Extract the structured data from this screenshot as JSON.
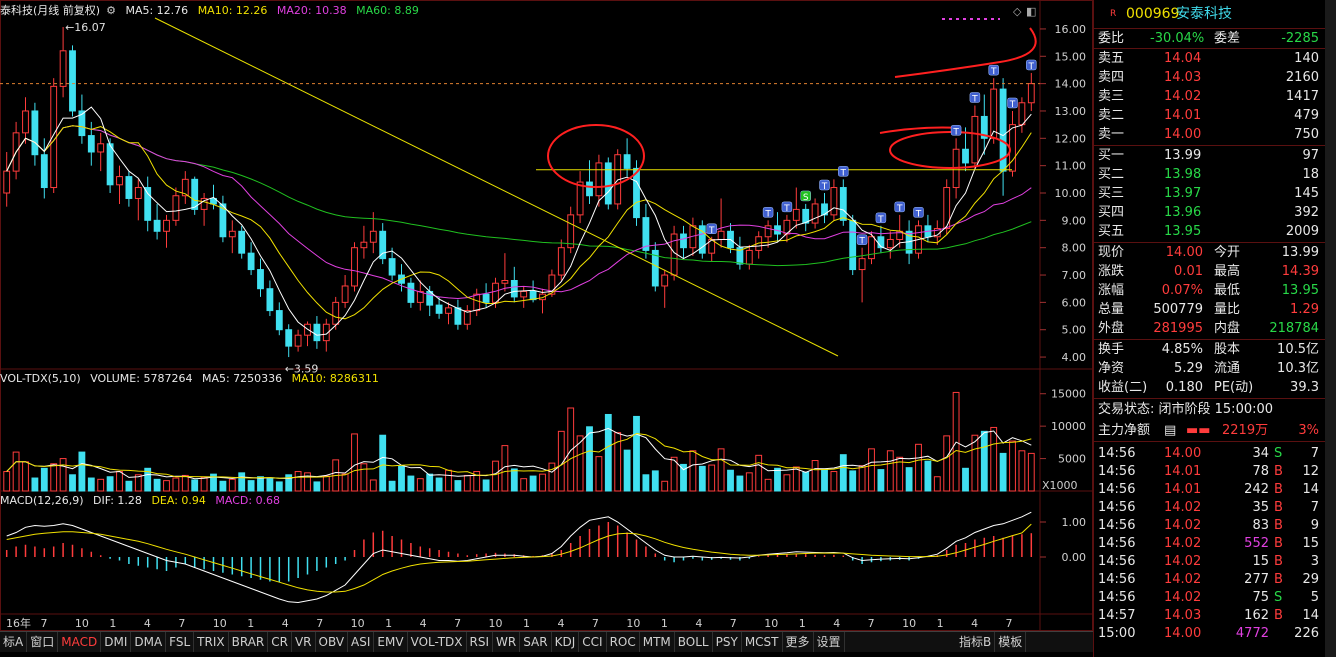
{
  "colors": {
    "up": "#ff3c3c",
    "down": "#40e0f0",
    "ma5": "#ffffff",
    "ma10": "#f0e000",
    "ma20": "#e040e0",
    "ma60": "#20c020",
    "grid": "#5a1010"
  },
  "main_header": {
    "title": "泰科技(月线 前复权)",
    "ma5": "MA5: 12.76",
    "ma10": "MA10: 12.26",
    "ma20": "MA20: 10.38",
    "ma60": "MA60: 8.89"
  },
  "price_axis": [
    "16.00",
    "15.00",
    "14.00",
    "13.00",
    "12.00",
    "11.00",
    "10.00",
    "9.00",
    "8.00",
    "7.00",
    "6.00",
    "5.00",
    "4.00"
  ],
  "annotations": {
    "high": "16.07",
    "low": "3.59"
  },
  "vol_header": {
    "name": "VOL-TDX(5,10)",
    "volume": "VOLUME: 5787264",
    "ma5": "MA5: 7250336",
    "ma10": "MA10: 8286311"
  },
  "vol_axis": [
    "15000",
    "10000",
    "5000"
  ],
  "vol_unit": "X1000",
  "macd_header": {
    "name": "MACD(12,26,9)",
    "dif": "DIF: 1.28",
    "dea": "DEA: 0.94",
    "macd": "MACD: 0.68"
  },
  "macd_axis": [
    "1.00",
    "0.00"
  ],
  "x_labels": [
    "16年",
    "7",
    "10",
    "1",
    "4",
    "7",
    "10",
    "1",
    "4",
    "7",
    "10",
    "1",
    "4",
    "7",
    "10",
    "1",
    "4",
    "7",
    "10",
    "1",
    "4",
    "7",
    "10",
    "1",
    "4",
    "7",
    "10",
    "1",
    "4",
    "7"
  ],
  "chart_data": {
    "type": "candlestick",
    "title": "泰科技(月线 前复权)",
    "ylim": [
      3.6,
      16.4
    ],
    "ohlc": [
      [
        10.0,
        11.5,
        9.5,
        10.8
      ],
      [
        10.8,
        12.6,
        10.5,
        12.2
      ],
      [
        12.2,
        13.5,
        11.8,
        13.0
      ],
      [
        13.0,
        13.3,
        11.0,
        11.4
      ],
      [
        11.4,
        12.0,
        9.8,
        10.2
      ],
      [
        10.2,
        14.2,
        10.0,
        13.9
      ],
      [
        13.9,
        16.07,
        13.5,
        15.2
      ],
      [
        15.2,
        15.4,
        12.8,
        13.0
      ],
      [
        13.0,
        13.6,
        11.8,
        12.1
      ],
      [
        12.1,
        12.6,
        11.0,
        11.5
      ],
      [
        11.5,
        12.2,
        10.8,
        11.8
      ],
      [
        11.8,
        12.0,
        10.0,
        10.3
      ],
      [
        10.3,
        11.0,
        9.6,
        10.6
      ],
      [
        10.6,
        10.8,
        9.5,
        9.8
      ],
      [
        9.8,
        10.5,
        9.0,
        10.2
      ],
      [
        10.2,
        10.6,
        8.6,
        9.0
      ],
      [
        9.0,
        9.6,
        8.3,
        8.6
      ],
      [
        8.6,
        9.2,
        8.0,
        9.0
      ],
      [
        9.0,
        10.2,
        8.8,
        9.9
      ],
      [
        9.9,
        10.8,
        9.6,
        10.5
      ],
      [
        10.5,
        10.6,
        9.2,
        9.4
      ],
      [
        9.4,
        10.0,
        8.8,
        9.8
      ],
      [
        9.8,
        10.3,
        9.4,
        9.6
      ],
      [
        9.6,
        9.9,
        8.2,
        8.4
      ],
      [
        8.4,
        9.0,
        7.8,
        8.6
      ],
      [
        8.6,
        8.8,
        7.6,
        7.8
      ],
      [
        7.8,
        8.2,
        7.0,
        7.2
      ],
      [
        7.2,
        7.6,
        6.2,
        6.5
      ],
      [
        6.5,
        6.8,
        5.5,
        5.7
      ],
      [
        5.7,
        6.0,
        4.8,
        5.0
      ],
      [
        5.0,
        5.2,
        4.0,
        4.4
      ],
      [
        4.4,
        5.0,
        4.2,
        4.8
      ],
      [
        4.8,
        5.3,
        4.4,
        5.2
      ],
      [
        5.2,
        5.5,
        4.3,
        4.6
      ],
      [
        4.6,
        5.4,
        4.2,
        5.2
      ],
      [
        5.2,
        6.2,
        5.0,
        6.0
      ],
      [
        6.0,
        7.0,
        5.8,
        6.6
      ],
      [
        6.6,
        8.2,
        6.4,
        8.0
      ],
      [
        8.0,
        8.8,
        7.6,
        8.2
      ],
      [
        8.2,
        9.3,
        7.8,
        8.6
      ],
      [
        8.6,
        8.9,
        7.4,
        7.6
      ],
      [
        7.6,
        8.0,
        6.8,
        7.0
      ],
      [
        7.0,
        7.4,
        6.4,
        6.7
      ],
      [
        6.7,
        6.9,
        5.8,
        6.0
      ],
      [
        6.0,
        6.8,
        5.7,
        6.4
      ],
      [
        6.4,
        6.6,
        5.5,
        5.9
      ],
      [
        5.9,
        6.2,
        5.4,
        5.6
      ],
      [
        5.6,
        6.0,
        5.2,
        5.8
      ],
      [
        5.8,
        6.1,
        5.0,
        5.2
      ],
      [
        5.2,
        5.9,
        5.0,
        5.7
      ],
      [
        5.7,
        6.5,
        5.5,
        6.3
      ],
      [
        6.3,
        6.7,
        5.8,
        6.0
      ],
      [
        6.0,
        6.9,
        5.8,
        6.7
      ],
      [
        6.7,
        7.8,
        6.4,
        6.8
      ],
      [
        6.8,
        7.3,
        6.0,
        6.2
      ],
      [
        6.2,
        6.6,
        5.8,
        6.4
      ],
      [
        6.4,
        6.8,
        6.0,
        6.1
      ],
      [
        6.1,
        6.5,
        5.6,
        6.3
      ],
      [
        6.3,
        7.2,
        6.2,
        7.0
      ],
      [
        7.0,
        8.3,
        6.8,
        8.0
      ],
      [
        8.0,
        9.5,
        7.8,
        9.2
      ],
      [
        9.2,
        10.8,
        8.9,
        10.4
      ],
      [
        10.4,
        11.2,
        9.6,
        9.9
      ],
      [
        9.9,
        11.4,
        9.5,
        11.1
      ],
      [
        11.1,
        11.3,
        9.4,
        9.6
      ],
      [
        9.6,
        11.6,
        9.4,
        11.4
      ],
      [
        11.4,
        12.0,
        10.6,
        10.9
      ],
      [
        10.9,
        11.2,
        8.8,
        9.1
      ],
      [
        9.1,
        9.6,
        7.6,
        7.9
      ],
      [
        7.9,
        8.2,
        6.4,
        6.6
      ],
      [
        6.6,
        7.2,
        5.8,
        7.0
      ],
      [
        7.0,
        8.8,
        6.8,
        8.5
      ],
      [
        8.5,
        8.8,
        7.6,
        8.0
      ],
      [
        8.0,
        9.1,
        7.7,
        8.8
      ],
      [
        8.8,
        9.0,
        7.6,
        7.8
      ],
      [
        7.8,
        8.4,
        7.5,
        8.3
      ],
      [
        8.3,
        9.8,
        8.0,
        8.6
      ],
      [
        8.6,
        8.9,
        7.8,
        8.0
      ],
      [
        8.0,
        8.4,
        7.2,
        7.4
      ],
      [
        7.4,
        8.1,
        7.2,
        7.9
      ],
      [
        7.9,
        8.6,
        7.6,
        8.4
      ],
      [
        8.4,
        9.0,
        8.0,
        8.8
      ],
      [
        8.8,
        9.3,
        8.2,
        8.5
      ],
      [
        8.5,
        9.2,
        8.2,
        9.0
      ],
      [
        9.0,
        10.2,
        8.7,
        9.4
      ],
      [
        9.4,
        9.6,
        8.6,
        8.9
      ],
      [
        8.9,
        9.8,
        8.7,
        9.6
      ],
      [
        9.6,
        10.0,
        8.9,
        9.2
      ],
      [
        9.2,
        10.5,
        9.0,
        10.2
      ],
      [
        10.2,
        10.5,
        8.8,
        9.0
      ],
      [
        9.0,
        9.2,
        7.0,
        7.2
      ],
      [
        7.2,
        8.0,
        6.0,
        7.6
      ],
      [
        7.6,
        8.6,
        7.4,
        8.4
      ],
      [
        8.4,
        8.8,
        7.8,
        8.0
      ],
      [
        8.0,
        8.6,
        7.6,
        8.3
      ],
      [
        8.3,
        9.2,
        8.0,
        8.6
      ],
      [
        8.6,
        9.0,
        7.4,
        7.8
      ],
      [
        7.8,
        9.0,
        7.6,
        8.8
      ],
      [
        8.8,
        9.2,
        8.2,
        8.4
      ],
      [
        8.4,
        9.0,
        8.1,
        8.7
      ],
      [
        8.7,
        10.5,
        8.5,
        10.2
      ],
      [
        10.2,
        12.0,
        9.8,
        11.6
      ],
      [
        11.6,
        12.4,
        10.8,
        11.1
      ],
      [
        11.1,
        13.2,
        10.9,
        12.8
      ],
      [
        12.8,
        13.6,
        11.4,
        12.0
      ],
      [
        12.0,
        14.2,
        11.8,
        13.8
      ],
      [
        13.8,
        14.2,
        9.9,
        10.8
      ],
      [
        10.8,
        13.0,
        10.6,
        12.5
      ],
      [
        12.5,
        13.5,
        12.2,
        13.3
      ],
      [
        13.3,
        14.39,
        13.0,
        14.0
      ]
    ],
    "volume": [
      3000,
      6000,
      4500,
      2000,
      3500,
      4200,
      5000,
      2500,
      6000,
      2000,
      1800,
      2200,
      3000,
      1500,
      2500,
      3500,
      1800,
      1600,
      2000,
      2400,
      1700,
      2100,
      2600,
      1500,
      1800,
      2800,
      1600,
      2200,
      1900,
      1400,
      2500,
      3000,
      2800,
      1400,
      2300,
      4800,
      2600,
      8800,
      4200,
      1700,
      8600,
      1500,
      3800,
      2300,
      1900,
      2600,
      2000,
      3200,
      1600,
      2400,
      3000,
      1700,
      4600,
      7000,
      3400,
      1900,
      2300,
      2600,
      4300,
      9200,
      12800,
      8500,
      9900,
      5300,
      11800,
      9000,
      6300,
      11500,
      2500,
      3100,
      1500,
      5200,
      4100,
      6200,
      3800,
      4000,
      6500,
      3200,
      2300,
      2800,
      5500,
      1800,
      3500,
      2500,
      3700,
      2900,
      4700,
      3400,
      3000,
      5600,
      3100,
      3900,
      6500,
      3300,
      6200,
      5200,
      3600,
      7200,
      4600,
      2200,
      8500,
      15200,
      3500,
      8600,
      9200,
      9800,
      5800,
      7700,
      6200,
      5800
    ],
    "macd_hist": [
      0.2,
      0.3,
      0.35,
      0.3,
      0.25,
      0.3,
      0.4,
      0.35,
      0.25,
      0.15,
      0.05,
      -0.05,
      -0.1,
      -0.2,
      -0.25,
      -0.3,
      -0.35,
      -0.4,
      -0.3,
      -0.2,
      -0.3,
      -0.35,
      -0.4,
      -0.45,
      -0.5,
      -0.55,
      -0.6,
      -0.65,
      -0.7,
      -0.72,
      -0.7,
      -0.6,
      -0.5,
      -0.4,
      -0.3,
      -0.2,
      -0.1,
      0.2,
      0.5,
      0.7,
      0.75,
      0.6,
      0.5,
      0.4,
      0.3,
      0.25,
      0.2,
      0.15,
      0.1,
      0.05,
      0.08,
      0.1,
      0.12,
      0.1,
      0.08,
      0.05,
      0.03,
      0.05,
      0.1,
      0.2,
      0.4,
      0.6,
      0.8,
      0.9,
      1.0,
      0.9,
      0.7,
      0.5,
      0.3,
      0.1,
      -0.1,
      -0.15,
      -0.1,
      -0.05,
      -0.1,
      -0.08,
      -0.05,
      -0.08,
      -0.1,
      -0.05,
      0.02,
      0.05,
      0.06,
      0.08,
      0.1,
      0.08,
      0.06,
      0.05,
      0.06,
      0.04,
      -0.1,
      -0.2,
      -0.15,
      -0.12,
      -0.1,
      -0.08,
      -0.1,
      -0.05,
      0.0,
      0.05,
      0.2,
      0.35,
      0.4,
      0.5,
      0.55,
      0.6,
      0.55,
      0.62,
      0.65,
      0.68
    ],
    "dif": [
      0.6,
      0.7,
      0.85,
      0.9,
      0.88,
      0.9,
      0.95,
      0.9,
      0.8,
      0.7,
      0.6,
      0.5,
      0.4,
      0.3,
      0.2,
      0.1,
      0.0,
      -0.1,
      -0.15,
      -0.2,
      -0.3,
      -0.4,
      -0.5,
      -0.6,
      -0.7,
      -0.8,
      -0.9,
      -1.0,
      -1.1,
      -1.2,
      -1.28,
      -1.3,
      -1.25,
      -1.2,
      -1.1,
      -0.95,
      -0.8,
      -0.5,
      -0.2,
      0.1,
      0.2,
      0.15,
      0.1,
      0.05,
      0.0,
      -0.05,
      -0.1,
      -0.1,
      -0.12,
      -0.1,
      -0.05,
      0.0,
      0.05,
      0.05,
      0.05,
      0.02,
      0.0,
      0.02,
      0.1,
      0.3,
      0.6,
      0.85,
      1.05,
      1.1,
      1.15,
      1.0,
      0.8,
      0.6,
      0.4,
      0.2,
      0.05,
      0.0,
      0.0,
      0.02,
      0.0,
      -0.02,
      -0.01,
      -0.02,
      -0.03,
      0.0,
      0.05,
      0.08,
      0.1,
      0.12,
      0.15,
      0.14,
      0.13,
      0.12,
      0.13,
      0.11,
      -0.02,
      -0.1,
      -0.08,
      -0.06,
      -0.05,
      -0.04,
      -0.05,
      -0.02,
      0.02,
      0.08,
      0.25,
      0.45,
      0.55,
      0.7,
      0.8,
      0.9,
      0.95,
      1.05,
      1.15,
      1.28
    ],
    "dea": [
      0.5,
      0.55,
      0.6,
      0.65,
      0.68,
      0.7,
      0.72,
      0.72,
      0.7,
      0.68,
      0.65,
      0.6,
      0.55,
      0.5,
      0.45,
      0.38,
      0.3,
      0.22,
      0.15,
      0.08,
      0.0,
      -0.08,
      -0.16,
      -0.24,
      -0.32,
      -0.4,
      -0.48,
      -0.56,
      -0.64,
      -0.72,
      -0.8,
      -0.88,
      -0.94,
      -0.98,
      -1.0,
      -1.0,
      -0.98,
      -0.9,
      -0.8,
      -0.65,
      -0.5,
      -0.4,
      -0.32,
      -0.25,
      -0.2,
      -0.17,
      -0.15,
      -0.14,
      -0.13,
      -0.12,
      -0.1,
      -0.08,
      -0.06,
      -0.04,
      -0.02,
      -0.01,
      0.0,
      0.01,
      0.03,
      0.08,
      0.16,
      0.26,
      0.38,
      0.5,
      0.6,
      0.66,
      0.68,
      0.66,
      0.6,
      0.52,
      0.42,
      0.34,
      0.27,
      0.22,
      0.18,
      0.14,
      0.11,
      0.08,
      0.06,
      0.05,
      0.05,
      0.06,
      0.07,
      0.08,
      0.09,
      0.1,
      0.11,
      0.11,
      0.11,
      0.11,
      0.09,
      0.07,
      0.05,
      0.04,
      0.03,
      0.02,
      0.01,
      0.01,
      0.01,
      0.02,
      0.06,
      0.12,
      0.2,
      0.28,
      0.36,
      0.45,
      0.53,
      0.61,
      0.69,
      0.94
    ]
  },
  "quote": {
    "code": "000969",
    "name": "安泰科技",
    "weibi_label": "委比",
    "weibi": "-30.04%",
    "weicha_label": "委差",
    "weicha": "-2285",
    "asks": [
      {
        "label": "卖五",
        "price": "14.04",
        "vol": "140"
      },
      {
        "label": "卖四",
        "price": "14.03",
        "vol": "2160"
      },
      {
        "label": "卖三",
        "price": "14.02",
        "vol": "1417"
      },
      {
        "label": "卖二",
        "price": "14.01",
        "vol": "479"
      },
      {
        "label": "卖一",
        "price": "14.00",
        "vol": "750"
      }
    ],
    "bids": [
      {
        "label": "买一",
        "price": "13.99",
        "vol": "97"
      },
      {
        "label": "买二",
        "price": "13.98",
        "vol": "18"
      },
      {
        "label": "买三",
        "price": "13.97",
        "vol": "145"
      },
      {
        "label": "买四",
        "price": "13.96",
        "vol": "392"
      },
      {
        "label": "买五",
        "price": "13.95",
        "vol": "2009"
      }
    ],
    "stats": [
      {
        "l1": "现价",
        "v1": "14.00",
        "l2": "今开",
        "v2": "13.99"
      },
      {
        "l1": "涨跌",
        "v1": "0.01",
        "l2": "最高",
        "v2": "14.39"
      },
      {
        "l1": "涨幅",
        "v1": "0.07%",
        "l2": "最低",
        "v2": "13.95"
      },
      {
        "l1": "总量",
        "v1": "500779",
        "l2": "量比",
        "v2": "1.29"
      },
      {
        "l1": "外盘",
        "v1": "281995",
        "l2": "内盘",
        "v2": "218784"
      }
    ],
    "fin": [
      {
        "l1": "换手",
        "v1": "4.85%",
        "l2": "股本",
        "v2": "10.5亿"
      },
      {
        "l1": "净资",
        "v1": "5.29",
        "l2": "流通",
        "v2": "10.3亿"
      },
      {
        "l1": "收益(二)",
        "v1": "0.180",
        "l2": "PE(动)",
        "v2": "39.3"
      }
    ],
    "status_label": "交易状态: 闭市阶段 15:00:00",
    "main_flow_label": "主力净额",
    "main_flow_value": "2219万",
    "main_flow_pct": "3%"
  },
  "trades": [
    {
      "t": "14:56",
      "p": "14.00",
      "v": "34",
      "s": "S",
      "n": "7"
    },
    {
      "t": "14:56",
      "p": "14.01",
      "v": "78",
      "s": "B",
      "n": "12"
    },
    {
      "t": "14:56",
      "p": "14.01",
      "v": "242",
      "s": "B",
      "n": "14"
    },
    {
      "t": "14:56",
      "p": "14.02",
      "v": "35",
      "s": "B",
      "n": "7"
    },
    {
      "t": "14:56",
      "p": "14.02",
      "v": "83",
      "s": "B",
      "n": "9"
    },
    {
      "t": "14:56",
      "p": "14.02",
      "v": "552",
      "s": "B",
      "n": "15"
    },
    {
      "t": "14:56",
      "p": "14.02",
      "v": "15",
      "s": "B",
      "n": "3"
    },
    {
      "t": "14:56",
      "p": "14.02",
      "v": "277",
      "s": "B",
      "n": "29"
    },
    {
      "t": "14:56",
      "p": "14.02",
      "v": "75",
      "s": "S",
      "n": "5"
    },
    {
      "t": "14:57",
      "p": "14.03",
      "v": "162",
      "s": "B",
      "n": "14"
    },
    {
      "t": "15:00",
      "p": "14.00",
      "v": "4772",
      "s": "",
      "n": "226"
    }
  ],
  "tabs": [
    "标A",
    "窗口",
    "MACD",
    "DMI",
    "DMA",
    "FSL",
    "TRIX",
    "BRAR",
    "CR",
    "VR",
    "OBV",
    "ASI",
    "EMV",
    "VOL-TDX",
    "RSI",
    "WR",
    "SAR",
    "KDJ",
    "CCI",
    "ROC",
    "MTM",
    "BOLL",
    "PSY",
    "MCST",
    "更多",
    "设置"
  ],
  "active_tab": "MACD",
  "right_tabs": [
    "指标B",
    "模板"
  ]
}
